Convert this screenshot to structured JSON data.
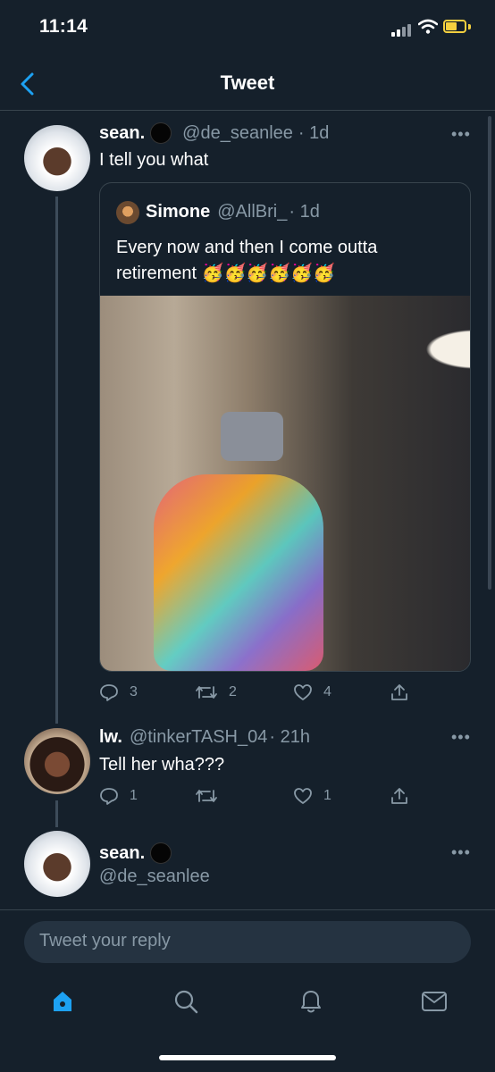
{
  "status_bar": {
    "time": "11:14"
  },
  "header": {
    "title": "Tweet"
  },
  "main_tweet": {
    "name": "sean.",
    "handle": "@de_seanlee",
    "time": "· 1d",
    "text": "I tell you what",
    "quote": {
      "name": "Simone",
      "handle": "@AllBri_",
      "time": "· 1d",
      "text_line1": "Every now and then I come outta",
      "text_line2": "retirement 🥳🥳🥳🥳🥳🥳"
    },
    "actions": {
      "replies": "3",
      "retweets": "2",
      "likes": "4"
    }
  },
  "reply_tweet": {
    "name": "lw.",
    "handle": "@tinkerTASH_04",
    "time": "· 21h",
    "text": "Tell her wha???",
    "actions": {
      "replies": "1",
      "retweets": "",
      "likes": "1"
    }
  },
  "self_row": {
    "name": "sean.",
    "handle": "@de_seanlee"
  },
  "reply_bar": {
    "placeholder": "Tweet your reply"
  },
  "tab_bar": {
    "tabs": [
      "home-icon",
      "search-icon",
      "notifications-icon",
      "messages-icon"
    ]
  },
  "colors": {
    "background": "#15202b",
    "accent": "#1da1f2",
    "muted": "#8899a6",
    "battery": "#f4d03f"
  }
}
